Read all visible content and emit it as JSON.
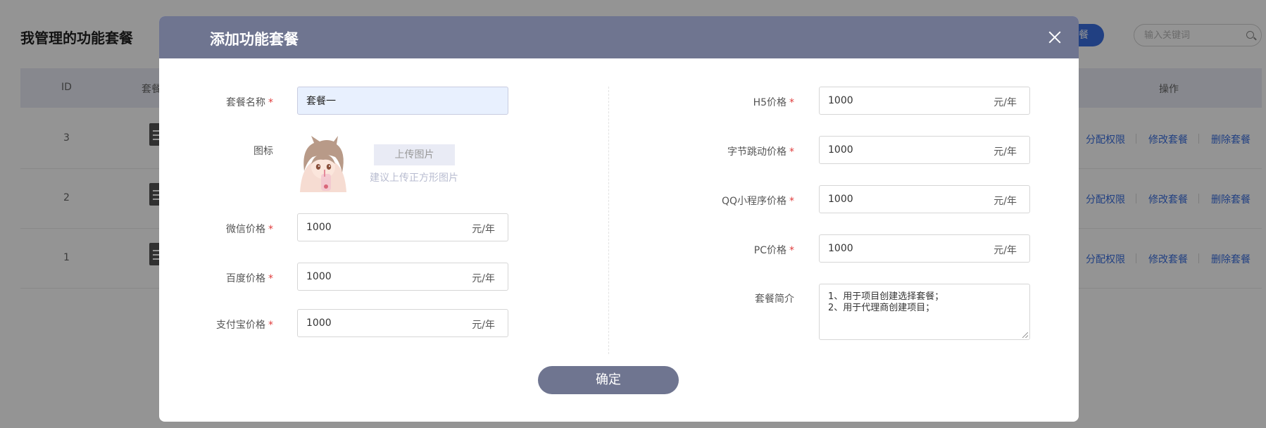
{
  "background": {
    "page_title": "我管理的功能套餐",
    "add_button_label": "餐",
    "search_placeholder": "输入关键词",
    "table_headers": {
      "id": "ID",
      "name": "套餐",
      "ops": "操作"
    },
    "rows": [
      {
        "id": "3",
        "ops": [
          "分配权限",
          "修改套餐",
          "删除套餐"
        ]
      },
      {
        "id": "2",
        "ops": [
          "分配权限",
          "修改套餐",
          "删除套餐"
        ]
      },
      {
        "id": "1",
        "ops": [
          "分配权限",
          "修改套餐",
          "删除套餐"
        ]
      }
    ]
  },
  "modal": {
    "title": "添加功能套餐",
    "required_mark": "*",
    "fields": {
      "package_name": {
        "label": "套餐名称",
        "value": "套餐一"
      },
      "icon": {
        "label": "图标",
        "upload_label": "上传图片",
        "hint": "建议上传正方形图片"
      },
      "wechat_price": {
        "label": "微信价格",
        "value": "1000",
        "unit": "元/年"
      },
      "baidu_price": {
        "label": "百度价格",
        "value": "1000",
        "unit": "元/年"
      },
      "alipay_price": {
        "label": "支付宝价格",
        "value": "1000",
        "unit": "元/年"
      },
      "h5_price": {
        "label": "H5价格",
        "value": "1000",
        "unit": "元/年"
      },
      "bytedance_price": {
        "label": "字节跳动价格",
        "value": "1000",
        "unit": "元/年"
      },
      "qq_price": {
        "label": "QQ小程序价格",
        "value": "1000",
        "unit": "元/年"
      },
      "pc_price": {
        "label": "PC价格",
        "value": "1000",
        "unit": "元/年"
      },
      "description": {
        "label": "套餐简介",
        "value": "1、用于项目创建选择套餐；\n2、用于代理商创建项目；"
      }
    },
    "confirm_label": "确定"
  },
  "colors": {
    "modal_header": "#6f7590",
    "accent_blue": "#3a6fe0",
    "required_red": "#e03c3c"
  },
  "icons": {
    "close": "close-icon",
    "search": "search-icon",
    "row_doc": "document-icon",
    "package_avatar": "anime-avatar-image"
  }
}
